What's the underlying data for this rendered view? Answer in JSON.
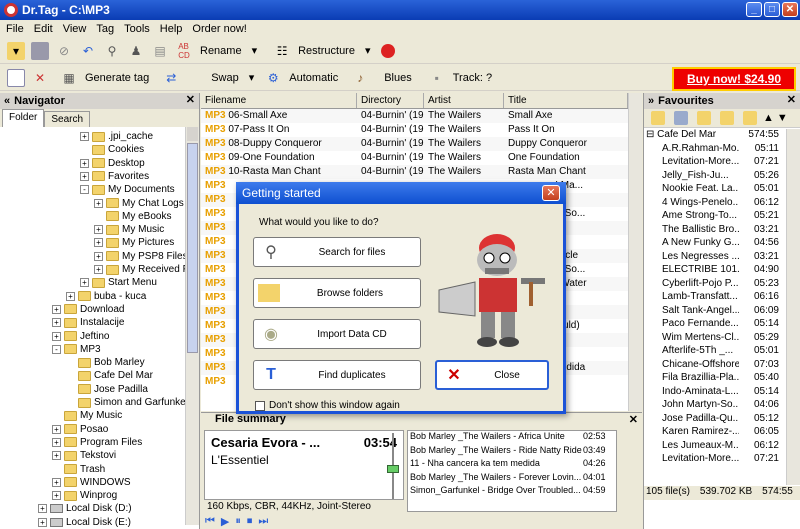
{
  "window": {
    "title": "Dr.Tag - C:\\MP3"
  },
  "menu": [
    "File",
    "Edit",
    "View",
    "Tag",
    "Tools",
    "Help",
    "Order now!"
  ],
  "toolbar1": {
    "rename": "Rename",
    "restructure": "Restructure"
  },
  "toolbar2": {
    "generate_tag": "Generate tag",
    "swap": "Swap",
    "automatic": "Automatic",
    "blues": "Blues",
    "track": "Track: ?"
  },
  "buy_now": "Buy now! $24.90",
  "navigator": {
    "title": "Navigator",
    "tabs": [
      "Folder",
      "Search"
    ],
    "tree": [
      {
        "label": ".jpi_cache",
        "level": 3,
        "pm": "+"
      },
      {
        "label": "Cookies",
        "level": 3,
        "pm": ""
      },
      {
        "label": "Desktop",
        "level": 3,
        "pm": "+"
      },
      {
        "label": "Favorites",
        "level": 3,
        "pm": "+"
      },
      {
        "label": "My Documents",
        "level": 3,
        "pm": "-"
      },
      {
        "label": "My Chat Logs",
        "level": 4,
        "pm": "+"
      },
      {
        "label": "My eBooks",
        "level": 4,
        "pm": ""
      },
      {
        "label": "My Music",
        "level": 4,
        "pm": "+"
      },
      {
        "label": "My Pictures",
        "level": 4,
        "pm": "+"
      },
      {
        "label": "My PSP8 Files",
        "level": 4,
        "pm": "+"
      },
      {
        "label": "My Received Fil",
        "level": 4,
        "pm": "+"
      },
      {
        "label": "Start Menu",
        "level": 3,
        "pm": "+"
      },
      {
        "label": "buba - kuca",
        "level": 2,
        "pm": "+"
      },
      {
        "label": "Download",
        "level": 1,
        "pm": "+"
      },
      {
        "label": "Instalacije",
        "level": 1,
        "pm": "+"
      },
      {
        "label": "Jeftino",
        "level": 1,
        "pm": "+"
      },
      {
        "label": "MP3",
        "level": 1,
        "pm": "-"
      },
      {
        "label": "Bob Marley",
        "level": 2,
        "pm": ""
      },
      {
        "label": "Cafe Del Mar",
        "level": 2,
        "pm": ""
      },
      {
        "label": "Jose Padilla",
        "level": 2,
        "pm": ""
      },
      {
        "label": "Simon and Garfunkel's",
        "level": 2,
        "pm": ""
      },
      {
        "label": "My Music",
        "level": 1,
        "pm": ""
      },
      {
        "label": "Posao",
        "level": 1,
        "pm": "+"
      },
      {
        "label": "Program Files",
        "level": 1,
        "pm": "+"
      },
      {
        "label": "Tekstovi",
        "level": 1,
        "pm": "+"
      },
      {
        "label": "Trash",
        "level": 1,
        "pm": ""
      },
      {
        "label": "WINDOWS",
        "level": 1,
        "pm": "+"
      },
      {
        "label": "Winprog",
        "level": 1,
        "pm": "+"
      },
      {
        "label": "Local Disk (D:)",
        "level": 0,
        "pm": "+",
        "drive": true
      },
      {
        "label": "Local Disk (E:)",
        "level": 0,
        "pm": "+",
        "drive": true
      }
    ]
  },
  "filelist": {
    "headers": [
      "Filename",
      "Directory",
      "Artist",
      "Title"
    ],
    "rows": [
      {
        "badge": "MP3",
        "name": "06-Small Axe",
        "dir": "04-Burnin' (19...",
        "artist": "The Wailers",
        "title": "Small Axe"
      },
      {
        "badge": "MP3",
        "name": "07-Pass It On",
        "dir": "04-Burnin' (19...",
        "artist": "The Wailers",
        "title": "Pass It On"
      },
      {
        "badge": "MP3",
        "name": "08-Duppy Conqueror",
        "dir": "04-Burnin' (19...",
        "artist": "The Wailers",
        "title": "Duppy Conqueror"
      },
      {
        "badge": "MP3",
        "name": "09-One Foundation",
        "dir": "04-Burnin' (19...",
        "artist": "The Wailers",
        "title": "One Foundation"
      },
      {
        "badge": "MP3",
        "name": "10-Rasta Man Chant",
        "dir": "04-Burnin' (19...",
        "artist": "The Wailers",
        "title": "Rasta Man Chant"
      }
    ],
    "partial": [
      {
        "badge": "MP3",
        "title": "ever I Ma..."
      },
      {
        "badge": "MP3",
        "title": ""
      },
      {
        "badge": "MP3",
        "title": "Bridge So..."
      },
      {
        "badge": "MP3",
        "title": "lence"
      },
      {
        "badge": "MP3",
        "title": ""
      },
      {
        "badge": "MP3",
        "title": "ir-Canticle"
      },
      {
        "badge": "MP3",
        "title": "Bridge So..."
      },
      {
        "badge": "MP3",
        "title": "ubled Water"
      },
      {
        "badge": "MP3",
        "title": ""
      },
      {
        "badge": "MP3",
        "title": ""
      },
      {
        "badge": "MP3",
        "title": "(If I Could)"
      },
      {
        "badge": "MP3",
        "title": ""
      },
      {
        "badge": "MP3",
        "title": ""
      },
      {
        "badge": "MP3",
        "title": "tem medida"
      },
      {
        "badge": "MP3",
        "title": ""
      }
    ]
  },
  "favourites": {
    "title": "Favourites",
    "group": "Cafe Del Mar",
    "group_size": "574:55",
    "items": [
      [
        "A.R.Rahman-Mo...",
        "05:11"
      ],
      [
        "Levitation-More...",
        "07:21"
      ],
      [
        "Jelly_Fish-Ju...",
        "05:26"
      ],
      [
        "Nookie Feat. La...",
        "05:01"
      ],
      [
        "4 Wings-Penelo...",
        "06:12"
      ],
      [
        "Ame Strong-To...",
        "05:21"
      ],
      [
        "The Ballistic Bro...",
        "03:21"
      ],
      [
        "A New Funky G...",
        "04:56"
      ],
      [
        "Les Negresses ...",
        "03:21"
      ],
      [
        "ELECTRIBE 101...",
        "04:90"
      ],
      [
        "Cyberlift-Pojo P...",
        "05:23"
      ],
      [
        "Lamb-Transfatt...",
        "06:16"
      ],
      [
        "Salt Tank-Angel...",
        "06:09"
      ],
      [
        "Paco Fernande...",
        "05:14"
      ],
      [
        "Wim Mertens-Cl...",
        "05:29"
      ],
      [
        "Afterlife-5Th _...",
        "05:01"
      ],
      [
        "Chicane-Offshore",
        "07:03"
      ],
      [
        "Fila Brazillia-Pla...",
        "05:40"
      ],
      [
        "Indo-Aminata-L...",
        "05:14"
      ],
      [
        "John Martyn-So...",
        "04:06"
      ],
      [
        "Jose Padilla-Qu...",
        "05:12"
      ],
      [
        "Karen Ramirez-...",
        "06:05"
      ],
      [
        "Les Jumeaux-M...",
        "06:12"
      ],
      [
        "Levitation-More...",
        "07:21"
      ]
    ],
    "files": "105 file(s)",
    "size": "539.702 KB",
    "total": "574:55"
  },
  "summary": {
    "title": "File summary",
    "artist": "Cesaria Evora - ...",
    "time": "03:54",
    "album": "L'Essentiel",
    "info": "160 Kbps, CBR, 44KHz, Joint-Stereo",
    "playlist": [
      [
        "Bob Marley _The Wailers - Africa Unite",
        "02:53"
      ],
      [
        "Bob Marley _The Wailers - Ride Natty Ride",
        "03:49"
      ],
      [
        "11 - Nha cancera ka tem medida",
        "04:26"
      ],
      [
        "Bob Marley _The Wailers - Forever Lovin...",
        "04:01"
      ],
      [
        "Simon_Garfunkel - Bridge Over Troubled...",
        "04:59"
      ]
    ]
  },
  "dialog": {
    "title": "Getting started",
    "question": "What would you like to do?",
    "search": "Search for files",
    "browse": "Browse folders",
    "import": "Import Data CD",
    "duplicates": "Find duplicates",
    "close": "Close",
    "dont_show": "Don't show this window again"
  },
  "colors": {
    "titlebar": "#0a3cb4",
    "buy_now": "#e00000",
    "mp3_badge": "#e8a000"
  }
}
